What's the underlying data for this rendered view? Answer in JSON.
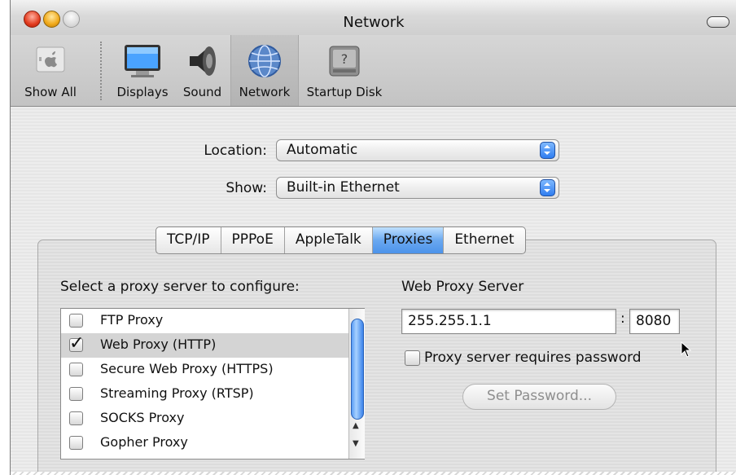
{
  "window": {
    "title": "Network"
  },
  "toolbar": {
    "items": [
      {
        "label": "Show All",
        "icon": "apple-icon"
      },
      {
        "label": "Displays",
        "icon": "display-icon"
      },
      {
        "label": "Sound",
        "icon": "speaker-icon"
      },
      {
        "label": "Network",
        "icon": "globe-icon",
        "selected": true
      },
      {
        "label": "Startup Disk",
        "icon": "hard-disk-icon"
      }
    ]
  },
  "location": {
    "label": "Location:",
    "value": "Automatic"
  },
  "show": {
    "label": "Show:",
    "value": "Built-in Ethernet"
  },
  "tabs": [
    "TCP/IP",
    "PPPoE",
    "AppleTalk",
    "Proxies",
    "Ethernet"
  ],
  "selected_tab": "Proxies",
  "proxy": {
    "list_title": "Select a proxy server to configure:",
    "items": [
      {
        "label": "FTP Proxy",
        "checked": false
      },
      {
        "label": "Web Proxy (HTTP)",
        "checked": true,
        "selected": true
      },
      {
        "label": "Secure Web Proxy (HTTPS)",
        "checked": false
      },
      {
        "label": "Streaming Proxy (RTSP)",
        "checked": false
      },
      {
        "label": "SOCKS Proxy",
        "checked": false
      },
      {
        "label": "Gopher Proxy",
        "checked": false
      }
    ],
    "server_title": "Web Proxy Server",
    "server": "255.255.1.1",
    "colon": ":",
    "port": "8080",
    "requires_password_label": "Proxy server requires password",
    "requires_password": false,
    "set_password_label": "Set Password..."
  }
}
